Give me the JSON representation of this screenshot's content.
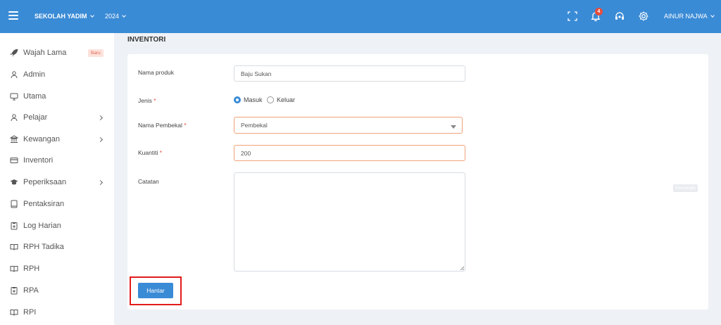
{
  "topbar": {
    "school": "SEKOLAH YADIM",
    "year": "2024",
    "notification_count": "4",
    "user": "AINUR NAJWA"
  },
  "sidebar": {
    "items": [
      {
        "label": "Wajah Lama",
        "icon": "rocket-icon",
        "badge": "Baru"
      },
      {
        "label": "Admin",
        "icon": "user-icon"
      },
      {
        "label": "Utama",
        "icon": "monitor-icon"
      },
      {
        "label": "Pelajar",
        "icon": "user-icon",
        "has_submenu": true
      },
      {
        "label": "Kewangan",
        "icon": "bank-icon",
        "has_submenu": true
      },
      {
        "label": "Inventori",
        "icon": "card-icon"
      },
      {
        "label": "Peperiksaan",
        "icon": "graduation-cap-icon",
        "has_submenu": true
      },
      {
        "label": "Pentaksiran",
        "icon": "book-icon"
      },
      {
        "label": "Log Harian",
        "icon": "clipboard-add-icon"
      },
      {
        "label": "RPH Tadika",
        "icon": "open-book-icon"
      },
      {
        "label": "RPH",
        "icon": "open-book-icon"
      },
      {
        "label": "RPA",
        "icon": "clipboard-add-icon"
      },
      {
        "label": "RPI",
        "icon": "open-book-icon"
      }
    ]
  },
  "page": {
    "title": "INVENTORI"
  },
  "form": {
    "product_label": "Nama produk",
    "product_value": "Baju Sukan",
    "type_label": "Jenis",
    "type_in": "Masuk",
    "type_out": "Keluar",
    "supplier_label": "Nama Pembekal",
    "supplier_value": "Pembekal",
    "quantity_label": "Kuantiti",
    "quantity_value": "200",
    "notes_label": "Catatan",
    "notes_value": "",
    "required_mark": "*",
    "submit_label": "Hantar"
  },
  "floating_tag": "Rectangle",
  "colors": {
    "topbar": "#3a8bd6",
    "primary_button": "#3a8bd6",
    "highlight": "#e31b1b",
    "required": "#e74c3c"
  }
}
